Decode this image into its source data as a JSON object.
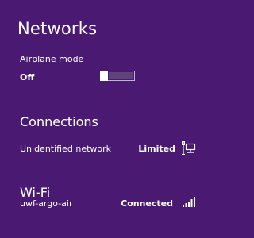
{
  "panel": {
    "title": "Networks"
  },
  "airplane_mode": {
    "label": "Airplane mode",
    "state": "Off"
  },
  "connections": {
    "heading": "Connections",
    "items": [
      {
        "name": "Unidentified network",
        "status": "Limited",
        "icon": "wired-network-icon"
      }
    ]
  },
  "wifi": {
    "heading": "Wi-Fi",
    "items": [
      {
        "name": "uwf-argo-air",
        "status": "Connected",
        "icon": "wifi-signal-icon",
        "signal_bars": 5
      }
    ]
  },
  "colors": {
    "background": "#4a1a73",
    "text": "#ffffff",
    "toggle_track": "#5e4577"
  }
}
